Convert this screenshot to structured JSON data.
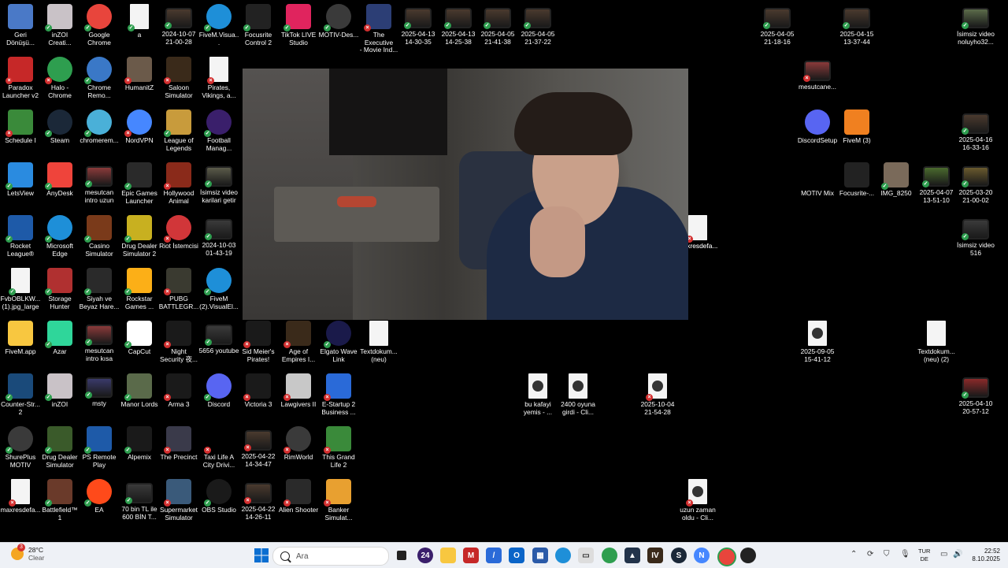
{
  "desktop": {
    "icons": [
      {
        "label": "Geri\nDönüşü...",
        "icon": "recycle-bin-icon",
        "color": "#4a79c7",
        "status": "none"
      },
      {
        "label": "inZOI\nCreati...",
        "icon": "cat-icon",
        "color": "#c9c2c7",
        "status": "ok"
      },
      {
        "label": "Google\nChrome",
        "icon": "chrome-icon",
        "color": "#e8453c",
        "status": "ok"
      },
      {
        "label": "a",
        "icon": "document-icon",
        "color": "#f4f4f4",
        "status": "ok"
      },
      {
        "label": "2024-10-07\n21-00-28",
        "icon": "video-file-icon",
        "color": "#4a3a2e",
        "status": "ok"
      },
      {
        "label": "FiveM.Visua...",
        "icon": "edge-icon",
        "color": "#1e8fd8",
        "status": "ok"
      },
      {
        "label": "Focusrite\nControl 2",
        "icon": "focusrite-icon",
        "color": "#222",
        "status": "ok"
      },
      {
        "label": "TikTok LIVE\nStudio",
        "icon": "tiktok-icon",
        "color": "#e0245e",
        "status": "ok"
      },
      {
        "label": "MOTIV-Des...",
        "icon": "motiv-icon",
        "color": "#3a3a3a",
        "status": "ok"
      },
      {
        "label": "The Executive\n- Movie Ind...",
        "icon": "game-icon",
        "color": "#2c3e75",
        "status": "err"
      },
      {
        "label": "2025-04-13\n14-30-35",
        "icon": "video-file-icon",
        "color": "#4a3a2e",
        "status": "ok"
      },
      {
        "label": "2025-04-13\n14-25-38",
        "icon": "video-file-icon",
        "color": "#4a3a2e",
        "status": "ok"
      },
      {
        "label": "2025-04-05\n21-41-38",
        "icon": "video-file-icon",
        "color": "#4a3a2e",
        "status": "ok"
      },
      {
        "label": "2025-04-05\n21-37-22",
        "icon": "video-file-icon",
        "color": "#4a3a2e",
        "status": "ok"
      },
      {
        "label": "2025-04-05\n21-18-16",
        "icon": "video-file-icon",
        "color": "#4a3a2e",
        "status": "ok"
      },
      {
        "label": "2025-04-15\n13-37-44",
        "icon": "video-file-icon",
        "color": "#4a3a2e",
        "status": "ok"
      },
      {
        "label": "İsimsiz video\nnoluyho32...",
        "icon": "video-file-icon",
        "color": "#5b6b4a",
        "status": "ok"
      },
      {
        "label": "Paradox\nLauncher v2",
        "icon": "paradox-icon",
        "color": "#c62828",
        "status": "err"
      },
      {
        "label": "Halo -\nChrome",
        "icon": "chrome-icon",
        "color": "#2e9e4f",
        "status": "err"
      },
      {
        "label": "Chrome\nRemo...",
        "icon": "chrome-remote-icon",
        "color": "#3a78c7",
        "status": "ok"
      },
      {
        "label": "HumanitZ",
        "icon": "game-icon",
        "color": "#6b5a4a",
        "status": "err"
      },
      {
        "label": "Saloon\nSimulator",
        "icon": "game-icon",
        "color": "#3a2a1a",
        "status": "err"
      },
      {
        "label": "Pirates,\nVikings, a...",
        "icon": "document-icon",
        "color": "#f4f4f4",
        "status": "err"
      },
      {
        "label": "mesutcane...",
        "icon": "video-file-icon",
        "color": "#8a3a3a",
        "status": "err"
      },
      {
        "label": "Schedule I",
        "icon": "game-icon",
        "color": "#3a8a3a",
        "status": "err"
      },
      {
        "label": "Steam",
        "icon": "steam-icon",
        "color": "#1b2838",
        "status": "ok"
      },
      {
        "label": "chromerem...",
        "icon": "chrome-remote-icon",
        "color": "#4ab0d8",
        "status": "ok"
      },
      {
        "label": "NordVPN",
        "icon": "nordvpn-icon",
        "color": "#4687ff",
        "status": "err"
      },
      {
        "label": "League of\nLegends",
        "icon": "lol-icon",
        "color": "#c89b3c",
        "status": "ok"
      },
      {
        "label": "Football\nManag...",
        "icon": "fm-icon",
        "color": "#3a1f6b",
        "status": "ok"
      },
      {
        "label": "DiscordSetup",
        "icon": "discord-icon",
        "color": "#5865f2",
        "status": "none"
      },
      {
        "label": "FiveM (3)",
        "icon": "fivem-icon",
        "color": "#f08020",
        "status": "none"
      },
      {
        "label": "2025-04-16\n16-33-16",
        "icon": "video-file-icon",
        "color": "#4a3a2e",
        "status": "ok"
      },
      {
        "label": "LetsView",
        "icon": "letsview-icon",
        "color": "#2a8be0",
        "status": "ok"
      },
      {
        "label": "AnyDesk",
        "icon": "anydesk-icon",
        "color": "#ef443b",
        "status": "ok"
      },
      {
        "label": "mesutcan\nintro uzun",
        "icon": "video-file-icon",
        "color": "#8a3a3a",
        "status": "ok"
      },
      {
        "label": "Epic Games\nLauncher",
        "icon": "epic-icon",
        "color": "#2a2a2a",
        "status": "ok"
      },
      {
        "label": "Hollywood\nAnimal",
        "icon": "game-icon",
        "color": "#8a2a1a",
        "status": "err"
      },
      {
        "label": "İsimsiz video\nkarilari getir",
        "icon": "video-file-icon",
        "color": "#5b5b4a",
        "status": "ok"
      },
      {
        "label": "MOTIV Mix",
        "icon": "motiv-mix-icon",
        "color": "#000",
        "status": "none"
      },
      {
        "label": "Focusrite-...",
        "icon": "focusrite-icon",
        "color": "#222",
        "status": "none"
      },
      {
        "label": "IMG_8250",
        "icon": "image-file-icon",
        "color": "#7a6a5a",
        "status": "ok"
      },
      {
        "label": "2025-04-07\n13-51-10",
        "icon": "video-file-icon",
        "color": "#4a6a2e",
        "status": "ok"
      },
      {
        "label": "2025-03-20\n21-00-02",
        "icon": "video-file-icon",
        "color": "#6a5a2e",
        "status": "ok"
      },
      {
        "label": "Rocket\nLeague®",
        "icon": "rocket-league-icon",
        "color": "#1e5aa8",
        "status": "ok"
      },
      {
        "label": "Microsoft\nEdge",
        "icon": "edge-icon",
        "color": "#1e8fd8",
        "status": "ok"
      },
      {
        "label": "Casino\nSimulator",
        "icon": "game-icon",
        "color": "#7a3a1a",
        "status": "ok"
      },
      {
        "label": "Drug Dealer\nSimulator 2",
        "icon": "game-icon",
        "color": "#c8b020",
        "status": "ok"
      },
      {
        "label": "Riot İstemcisi",
        "icon": "riot-icon",
        "color": "#d13639",
        "status": "err"
      },
      {
        "label": "2024-10-03\n01-43-19",
        "icon": "video-file-icon",
        "color": "#3a3a3a",
        "status": "ok"
      },
      {
        "label": "maxresdefa...",
        "icon": "image-file-icon",
        "color": "#f4f4f4",
        "status": "err"
      },
      {
        "label": "İsimsiz video\n516",
        "icon": "video-file-icon",
        "color": "#3a3a3a",
        "status": "ok"
      },
      {
        "label": "FvbOBLKW...\n(1).jpg_large",
        "icon": "document-icon",
        "color": "#f4f4f4",
        "status": "ok"
      },
      {
        "label": "Storage\nHunter",
        "icon": "game-icon",
        "color": "#b03030",
        "status": "ok"
      },
      {
        "label": "Siyah ve\nBeyaz Hare...",
        "icon": "image-file-icon",
        "color": "#2a2a2a",
        "status": "ok"
      },
      {
        "label": "Rockstar\nGames ...",
        "icon": "rockstar-icon",
        "color": "#fcaf17",
        "status": "ok"
      },
      {
        "label": "PUBG\nBATTLEGR...",
        "icon": "game-icon",
        "color": "#3a3a30",
        "status": "err"
      },
      {
        "label": "FiveM\n(2).VisualEl...",
        "icon": "edge-icon",
        "color": "#1e8fd8",
        "status": "ok"
      },
      {
        "label": "FiveM.app",
        "icon": "folder-icon",
        "color": "#f8c740",
        "status": "none"
      },
      {
        "label": "Azar",
        "icon": "azar-icon",
        "color": "#2fd69a",
        "status": "ok"
      },
      {
        "label": "mesutcan\nintro kısa",
        "icon": "video-file-icon",
        "color": "#8a3a3a",
        "status": "ok"
      },
      {
        "label": "CapCut",
        "icon": "capcut-icon",
        "color": "#fff",
        "status": "ok"
      },
      {
        "label": "Night\nSecurity 夜...",
        "icon": "game-icon",
        "color": "#1a1a1a",
        "status": "err"
      },
      {
        "label": "5656 youtube",
        "icon": "video-file-icon",
        "color": "#3a3a3a",
        "status": "ok"
      },
      {
        "label": "Sid Meier's\nPirates!",
        "icon": "game-icon",
        "color": "#1a1a1a",
        "status": "err"
      },
      {
        "label": "Age of\nEmpires I...",
        "icon": "game-icon",
        "color": "#3a2a1a",
        "status": "err"
      },
      {
        "label": "Elgato Wave\nLink",
        "icon": "elgato-icon",
        "color": "#1a1a4a",
        "status": "ok"
      },
      {
        "label": "Textdokum...\n(neu)",
        "icon": "document-icon",
        "color": "#f4f4f4",
        "status": "none"
      },
      {
        "label": "2025-09-05\n15-41-12",
        "icon": "media-file-icon",
        "color": "#f4f4f4",
        "status": "none"
      },
      {
        "label": "Textdokum...\n(neu) (2)",
        "icon": "document-icon",
        "color": "#f4f4f4",
        "status": "none"
      },
      {
        "label": "Counter-Str...\n2",
        "icon": "cs2-icon",
        "color": "#1a4a7a",
        "status": "ok"
      },
      {
        "label": "inZOI",
        "icon": "cat-icon",
        "color": "#c9c2c7",
        "status": "ok"
      },
      {
        "label": "msty",
        "icon": "video-file-icon",
        "color": "#3a3a6a",
        "status": "ok"
      },
      {
        "label": "Manor Lords",
        "icon": "game-icon",
        "color": "#5a6a4a",
        "status": "ok"
      },
      {
        "label": "Arma 3",
        "icon": "arma-icon",
        "color": "#1a1a1a",
        "status": "err"
      },
      {
        "label": "Discord",
        "icon": "discord-icon",
        "color": "#5865f2",
        "status": "ok"
      },
      {
        "label": "Victoria 3",
        "icon": "victoria-icon",
        "color": "#1a1a1a",
        "status": "err"
      },
      {
        "label": "Lawgivers II",
        "icon": "game-icon",
        "color": "#c8c8c8",
        "status": "err"
      },
      {
        "label": "E-Startup 2\nBusiness ...",
        "icon": "game-icon",
        "color": "#2a6ad8",
        "status": "err"
      },
      {
        "label": "bu kafayi\nyemis - ...",
        "icon": "media-file-icon",
        "color": "#f4f4f4",
        "status": "none"
      },
      {
        "label": "2400 oyuna\ngirdi - Cli...",
        "icon": "media-file-icon",
        "color": "#f4f4f4",
        "status": "none"
      },
      {
        "label": "2025-10-04\n21-54-28",
        "icon": "media-file-icon",
        "color": "#f4f4f4",
        "status": "err"
      },
      {
        "label": "2025-04-10\n20-57-12",
        "icon": "video-file-icon",
        "color": "#8a2a2a",
        "status": "ok"
      },
      {
        "label": "ShurePlus\nMOTIV",
        "icon": "motiv-icon",
        "color": "#3a3a3a",
        "status": "ok"
      },
      {
        "label": "Drug Dealer\nSimulator",
        "icon": "game-icon",
        "color": "#3a5a2a",
        "status": "ok"
      },
      {
        "label": "PS Remote\nPlay",
        "icon": "ps-remote-icon",
        "color": "#1e5aa8",
        "status": "ok"
      },
      {
        "label": "Alpemix",
        "icon": "alpemix-icon",
        "color": "#1a1a1a",
        "status": "ok"
      },
      {
        "label": "The Precinct",
        "icon": "game-icon",
        "color": "#3a3a4a",
        "status": "err"
      },
      {
        "label": "Taxi Life A\nCity Drivi...",
        "icon": "taxi-icon",
        "color": "#000",
        "status": "err"
      },
      {
        "label": "2025-04-22\n14-34-47",
        "icon": "video-file-icon",
        "color": "#4a3a2e",
        "status": "err"
      },
      {
        "label": "RimWorld",
        "icon": "rimworld-icon",
        "color": "#3a3a3a",
        "status": "err"
      },
      {
        "label": "This Grand\nLife 2",
        "icon": "game-icon",
        "color": "#3a8a3a",
        "status": "err"
      },
      {
        "label": "maxresdefa...",
        "icon": "image-file-icon",
        "color": "#f4f4f4",
        "status": "err"
      },
      {
        "label": "Battlefield™ 1",
        "icon": "game-icon",
        "color": "#6a3a2a",
        "status": "ok"
      },
      {
        "label": "EA",
        "icon": "ea-icon",
        "color": "#ff4a1a",
        "status": "ok"
      },
      {
        "label": "70 bin TL ile\n600 BİN T...",
        "icon": "video-file-icon",
        "color": "#3a3a3a",
        "status": "ok"
      },
      {
        "label": "Supermarket\nSimulator",
        "icon": "game-icon",
        "color": "#3a5a7a",
        "status": "err"
      },
      {
        "label": "OBS Studio",
        "icon": "obs-icon",
        "color": "#1a1a1a",
        "status": "ok"
      },
      {
        "label": "2025-04-22\n14-26-11",
        "icon": "video-file-icon",
        "color": "#4a3a2e",
        "status": "err"
      },
      {
        "label": "Alien Shooter",
        "icon": "game-icon",
        "color": "#2a2a2a",
        "status": "err"
      },
      {
        "label": "Banker\nSimulat...",
        "icon": "game-icon",
        "color": "#e8a030",
        "status": "err"
      },
      {
        "label": "uzun zaman\noldu - Cli...",
        "icon": "media-file-icon",
        "color": "#f4f4f4",
        "status": "err"
      },
      {
        "label": "maxresdefa...",
        "icon": "image-file-icon",
        "color": "#f4f4f4",
        "status": "err"
      }
    ]
  },
  "taskbar": {
    "weather": {
      "temp": "28°C",
      "condition": "Clear",
      "badge": "3"
    },
    "search_placeholder": "Ara",
    "language": {
      "line1": "TUR",
      "line2": "DE"
    },
    "clock": {
      "time": "22:52",
      "date": "8.10.2025"
    }
  }
}
